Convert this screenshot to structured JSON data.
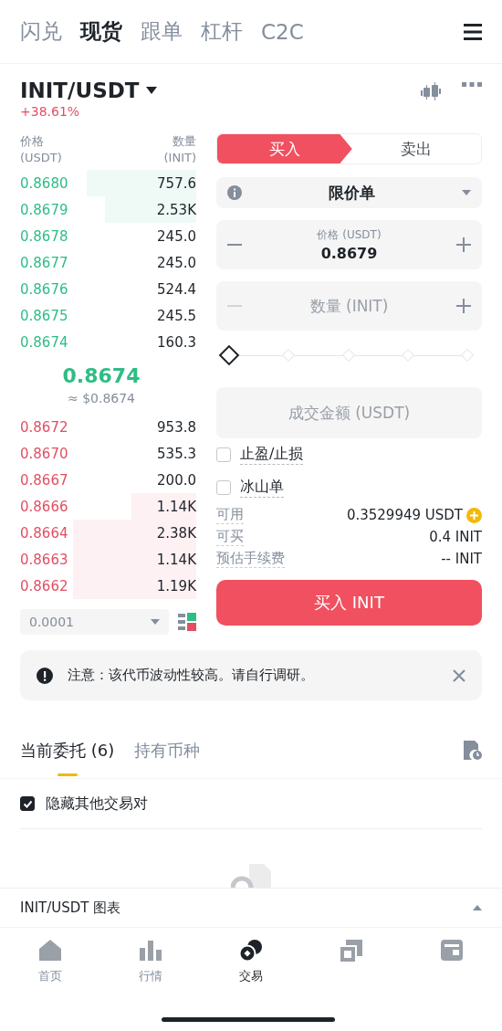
{
  "top_tabs": [
    {
      "label": "闪兑",
      "selected": false
    },
    {
      "label": "现货",
      "selected": true
    },
    {
      "label": "跟单",
      "selected": false
    },
    {
      "label": "杠杆",
      "selected": false
    },
    {
      "label": "C2C",
      "selected": false
    }
  ],
  "pair": {
    "symbol": "INIT/USDT",
    "change": "+38.61%"
  },
  "order_book": {
    "price_header": "价格",
    "price_unit": "(USDT)",
    "amount_header": "数量",
    "amount_unit": "(INIT)",
    "upper_rows": [
      {
        "price": "0.8680",
        "amount": "757.6"
      },
      {
        "price": "0.8679",
        "amount": "2.53K"
      },
      {
        "price": "0.8678",
        "amount": "245.0"
      },
      {
        "price": "0.8677",
        "amount": "245.0"
      },
      {
        "price": "0.8676",
        "amount": "524.4"
      },
      {
        "price": "0.8675",
        "amount": "245.5"
      },
      {
        "price": "0.8674",
        "amount": "160.3"
      }
    ],
    "last_price": "0.8674",
    "last_price_usd": "≈ $0.8674",
    "lower_rows": [
      {
        "price": "0.8672",
        "amount": "953.8"
      },
      {
        "price": "0.8670",
        "amount": "535.3"
      },
      {
        "price": "0.8667",
        "amount": "200.0"
      },
      {
        "price": "0.8666",
        "amount": "1.14K"
      },
      {
        "price": "0.8664",
        "amount": "2.38K"
      },
      {
        "price": "0.8663",
        "amount": "1.14K"
      },
      {
        "price": "0.8662",
        "amount": "1.19K"
      }
    ],
    "precision": "0.0001"
  },
  "order_form": {
    "sides": [
      {
        "label": "买入",
        "selected": true
      },
      {
        "label": "卖出",
        "selected": false
      }
    ],
    "order_type": "限价单",
    "price": {
      "label": "价格 (USDT)",
      "value": "0.8679"
    },
    "quantity": {
      "placeholder": "数量 (INIT)"
    },
    "slider": {
      "level": 0
    },
    "total": {
      "placeholder": "成交金额 (USDT)"
    },
    "options": [
      {
        "label": "止盈/止损",
        "checked": false
      },
      {
        "label": "冰山单",
        "checked": false
      }
    ],
    "info": [
      {
        "label": "可用",
        "value": "0.3529949 USDT",
        "kind": "add"
      },
      {
        "label": "可买",
        "value": "0.4 INIT",
        "kind": "plain"
      },
      {
        "label": "预估手续费",
        "value": "-- INIT",
        "kind": "plain"
      }
    ],
    "submit": "买入 INIT"
  },
  "notice": {
    "text": "注意：该代币波动性较高。请自行调研。"
  },
  "order_tabs": [
    {
      "label": "当前委托 (6)",
      "selected": true
    },
    {
      "label": "持有币种",
      "selected": false
    }
  ],
  "hide_other_pairs": {
    "label": "隐藏其他交易对",
    "checked": true
  },
  "chart_bar": {
    "label": "INIT/USDT 图表"
  },
  "bottom_nav": [
    {
      "label": "首页",
      "kind": "home",
      "selected": false
    },
    {
      "label": "行情",
      "kind": "bars",
      "selected": false
    },
    {
      "label": "交易",
      "kind": "coins",
      "selected": true
    },
    {
      "kind": "transfer",
      "selected": false
    },
    {
      "kind": "wallet",
      "selected": false
    }
  ]
}
